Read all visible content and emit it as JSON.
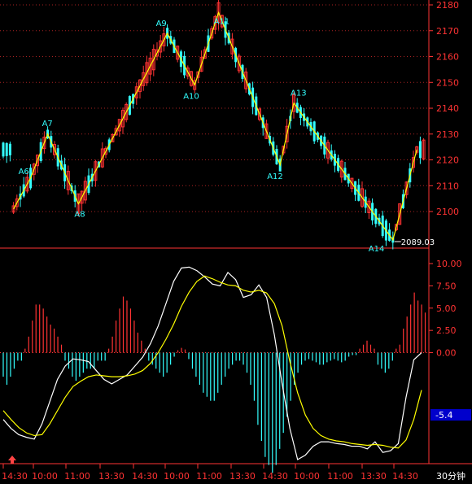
{
  "chart_data": [
    {
      "type": "candlestick",
      "panel": "price",
      "ylim": [
        2089,
        2180
      ],
      "y_ticks": [
        2100,
        2110,
        2120,
        2130,
        2140,
        2150,
        2160,
        2170,
        2180
      ],
      "zigzag": {
        "points": [
          {
            "label": "",
            "x": 3,
            "y": 2101
          },
          {
            "label": "A6",
            "x": 8,
            "y": 2113
          },
          {
            "label": "A7",
            "x": 13,
            "y": 2130
          },
          {
            "label": "A8",
            "x": 22,
            "y": 2103
          },
          {
            "label": "A9",
            "x": 48,
            "y": 2169
          },
          {
            "label": "A10",
            "x": 56,
            "y": 2149
          },
          {
            "label": "A11",
            "x": 63,
            "y": 2177
          },
          {
            "label": "A12",
            "x": 81,
            "y": 2118
          },
          {
            "label": "A13",
            "x": 85,
            "y": 2142
          },
          {
            "label": "A14",
            "x": 114,
            "y": 2089
          },
          {
            "label": "",
            "x": 121,
            "y": 2124
          }
        ],
        "color": "#ffff00"
      },
      "low_annotation": "2089.03",
      "colors": {
        "up": "#ff3333",
        "down": "#33ffff",
        "axis": "#ff3333"
      }
    },
    {
      "type": "macd",
      "panel": "indicator",
      "ylim": [
        -10,
        10
      ],
      "y_ticks": [
        "10.00",
        "7.50",
        "5.00",
        "2.50",
        "0.00"
      ],
      "current_value": "-5.4",
      "dif": [
        -7.5,
        -8.5,
        -9.2,
        -9.5,
        -9.7,
        -8.0,
        -5.5,
        -3.0,
        -1.5,
        -0.7,
        -0.8,
        -1.0,
        -2.0,
        -3.0,
        -3.5,
        -3.0,
        -2.5,
        -1.5,
        -0.5,
        1.0,
        3.0,
        5.5,
        8.0,
        9.5,
        9.6,
        9.2,
        8.5,
        7.7,
        7.5,
        9.0,
        8.2,
        6.2,
        6.5,
        7.6,
        6.2,
        2.0,
        -3.5,
        -8.5,
        -12.0,
        -11.5,
        -10.5,
        -10.0,
        -10.0,
        -10.2,
        -10.3,
        -10.5,
        -10.5,
        -10.8,
        -10.0,
        -11.2,
        -11.0,
        -10.2,
        -5.0,
        -0.8,
        0.0
      ],
      "dea": [
        -6.5,
        -7.5,
        -8.4,
        -9.0,
        -9.3,
        -9.2,
        -8.0,
        -6.5,
        -5.0,
        -3.8,
        -3.2,
        -2.7,
        -2.5,
        -2.6,
        -2.7,
        -2.7,
        -2.6,
        -2.4,
        -2.0,
        -1.2,
        0.0,
        1.5,
        3.2,
        5.2,
        6.8,
        8.0,
        8.6,
        8.3,
        7.9,
        7.6,
        7.5,
        7.0,
        6.8,
        7.0,
        6.7,
        5.5,
        3.0,
        -1.0,
        -4.5,
        -7.0,
        -8.5,
        -9.3,
        -9.7,
        -9.9,
        -10.0,
        -10.2,
        -10.3,
        -10.4,
        -10.3,
        -10.4,
        -10.6,
        -10.7,
        -9.8,
        -7.5,
        -4.2
      ],
      "hist": [
        -3,
        -4,
        -3,
        -2,
        -1,
        -1,
        0.5,
        2,
        4,
        6,
        6,
        5.5,
        4.5,
        3.5,
        3,
        2,
        1,
        -1,
        -2,
        -3,
        -3.5,
        -3,
        -2.5,
        -2,
        -2,
        -2,
        -1,
        -1,
        -1,
        0.5,
        2,
        4,
        5.5,
        7,
        6.5,
        5.5,
        4,
        2.5,
        1.5,
        0.5,
        -1,
        -1.5,
        -2,
        -2.5,
        -3,
        -2.5,
        -1.5,
        -0.5,
        0.3,
        0.6,
        0.4,
        -0.8,
        -2,
        -3,
        -4,
        -5,
        -5.5,
        -6,
        -6,
        -5,
        -4,
        -3,
        -2,
        -1.5,
        -1,
        -1,
        -1.5,
        -2.5,
        -4,
        -6,
        -9,
        -11,
        -13,
        -14,
        -15,
        -14,
        -12,
        -10,
        -8,
        -6,
        -4,
        -2.5,
        -1.5,
        -1,
        -0.8,
        -1,
        -1.2,
        -1.5,
        -1.5,
        -1.2,
        -1,
        -0.8,
        -1,
        -1.2,
        -1,
        -0.5,
        -0.3,
        -0.3,
        0.5,
        1,
        1.5,
        1,
        0.5,
        -1.5,
        -2,
        -2.5,
        -2,
        -1,
        0.5,
        1,
        3,
        4.5,
        6,
        7.5,
        6.5,
        6,
        5
      ],
      "colors": {
        "dif": "#ffffff",
        "dea": "#ffff00",
        "hist_pos": "#ff3333",
        "hist_neg": "#33ffff"
      }
    }
  ],
  "x_axis": {
    "labels": [
      "14:30",
      "10:00",
      "11:00",
      "13:30",
      "14:30",
      "10:00",
      "11:00",
      "13:30",
      "14:30",
      "10:00",
      "11:00",
      "13:30",
      "14:30"
    ],
    "unit": "30分钟"
  }
}
